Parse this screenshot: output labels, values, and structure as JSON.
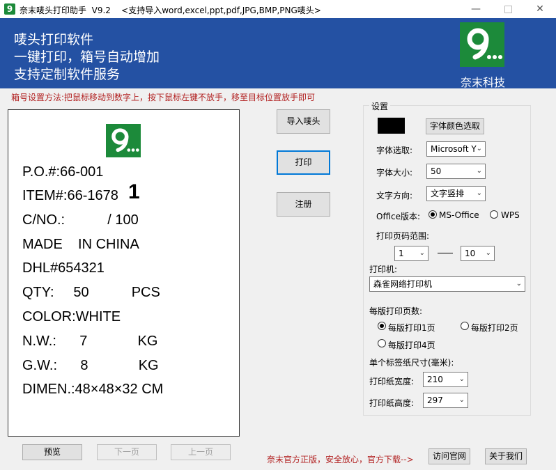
{
  "window": {
    "title": "奈末唛头打印助手  V9.2    <支持导入word,excel,ppt,pdf,JPG,BMP,PNG唛头>",
    "minimize_icon": "minimize-icon",
    "maximize_icon": "maximize-icon",
    "close_icon": "close-icon"
  },
  "banner": {
    "line1": "唛头打印软件",
    "line2": "一键打印，箱号自动增加",
    "line3": "支持定制软件服务",
    "logo_text": "9...",
    "company": "奈末科技"
  },
  "hint": "箱号设置方法:把鼠标移动到数字上，按下鼠标左键不放手，移至目标位置放手即可",
  "preview": {
    "logo_text": "9...",
    "lines": {
      "po": "P.O.#:66-001",
      "item": "ITEM#:66-1678",
      "item_count": "1",
      "cno": "C/NO.:           / 100",
      "made": "MADE    IN CHINA",
      "dhl": "DHL#654321",
      "qty": "QTY:     50           PCS",
      "color": "COLOR:WHITE",
      "nw": "N.W.:      7             KG",
      "gw": "G.W.:      8             KG",
      "dimen": "DIMEN.:48×48×32 CM"
    }
  },
  "actions": {
    "import": "导入唛头",
    "print": "打印",
    "register": "注册"
  },
  "settings": {
    "group_title": "设置",
    "font_color_button": "字体颜色选取",
    "font_label": "字体选取:",
    "font_value": "Microsoft Y",
    "size_label": "字体大小:",
    "size_value": "50",
    "direction_label": "文字方向:",
    "direction_value": "文字竖排",
    "office_label": "Office版本:",
    "office_ms": "MS-Office",
    "office_wps": "WPS",
    "page_range_label": "打印页码范围:",
    "range_from": "1",
    "range_to": "10",
    "printer_label": "打印机:",
    "printer_value": "森雀网络打印机",
    "per_sheet_label": "每版打印页数:",
    "per_sheet_1": "每版打印1页",
    "per_sheet_2": "每版打印2页",
    "per_sheet_4": "每版打印4页",
    "label_size_title": "单个标签纸尺寸(毫米):",
    "width_label": "打印纸宽度:",
    "width_value": "210",
    "height_label": "打印纸高度:",
    "height_value": "297"
  },
  "nav": {
    "preview": "预览",
    "next": "下一页",
    "prev": "上一页"
  },
  "footer": {
    "note": "奈末官方正版，安全放心，官方下载-->",
    "website": "访问官网",
    "about": "关于我们"
  }
}
